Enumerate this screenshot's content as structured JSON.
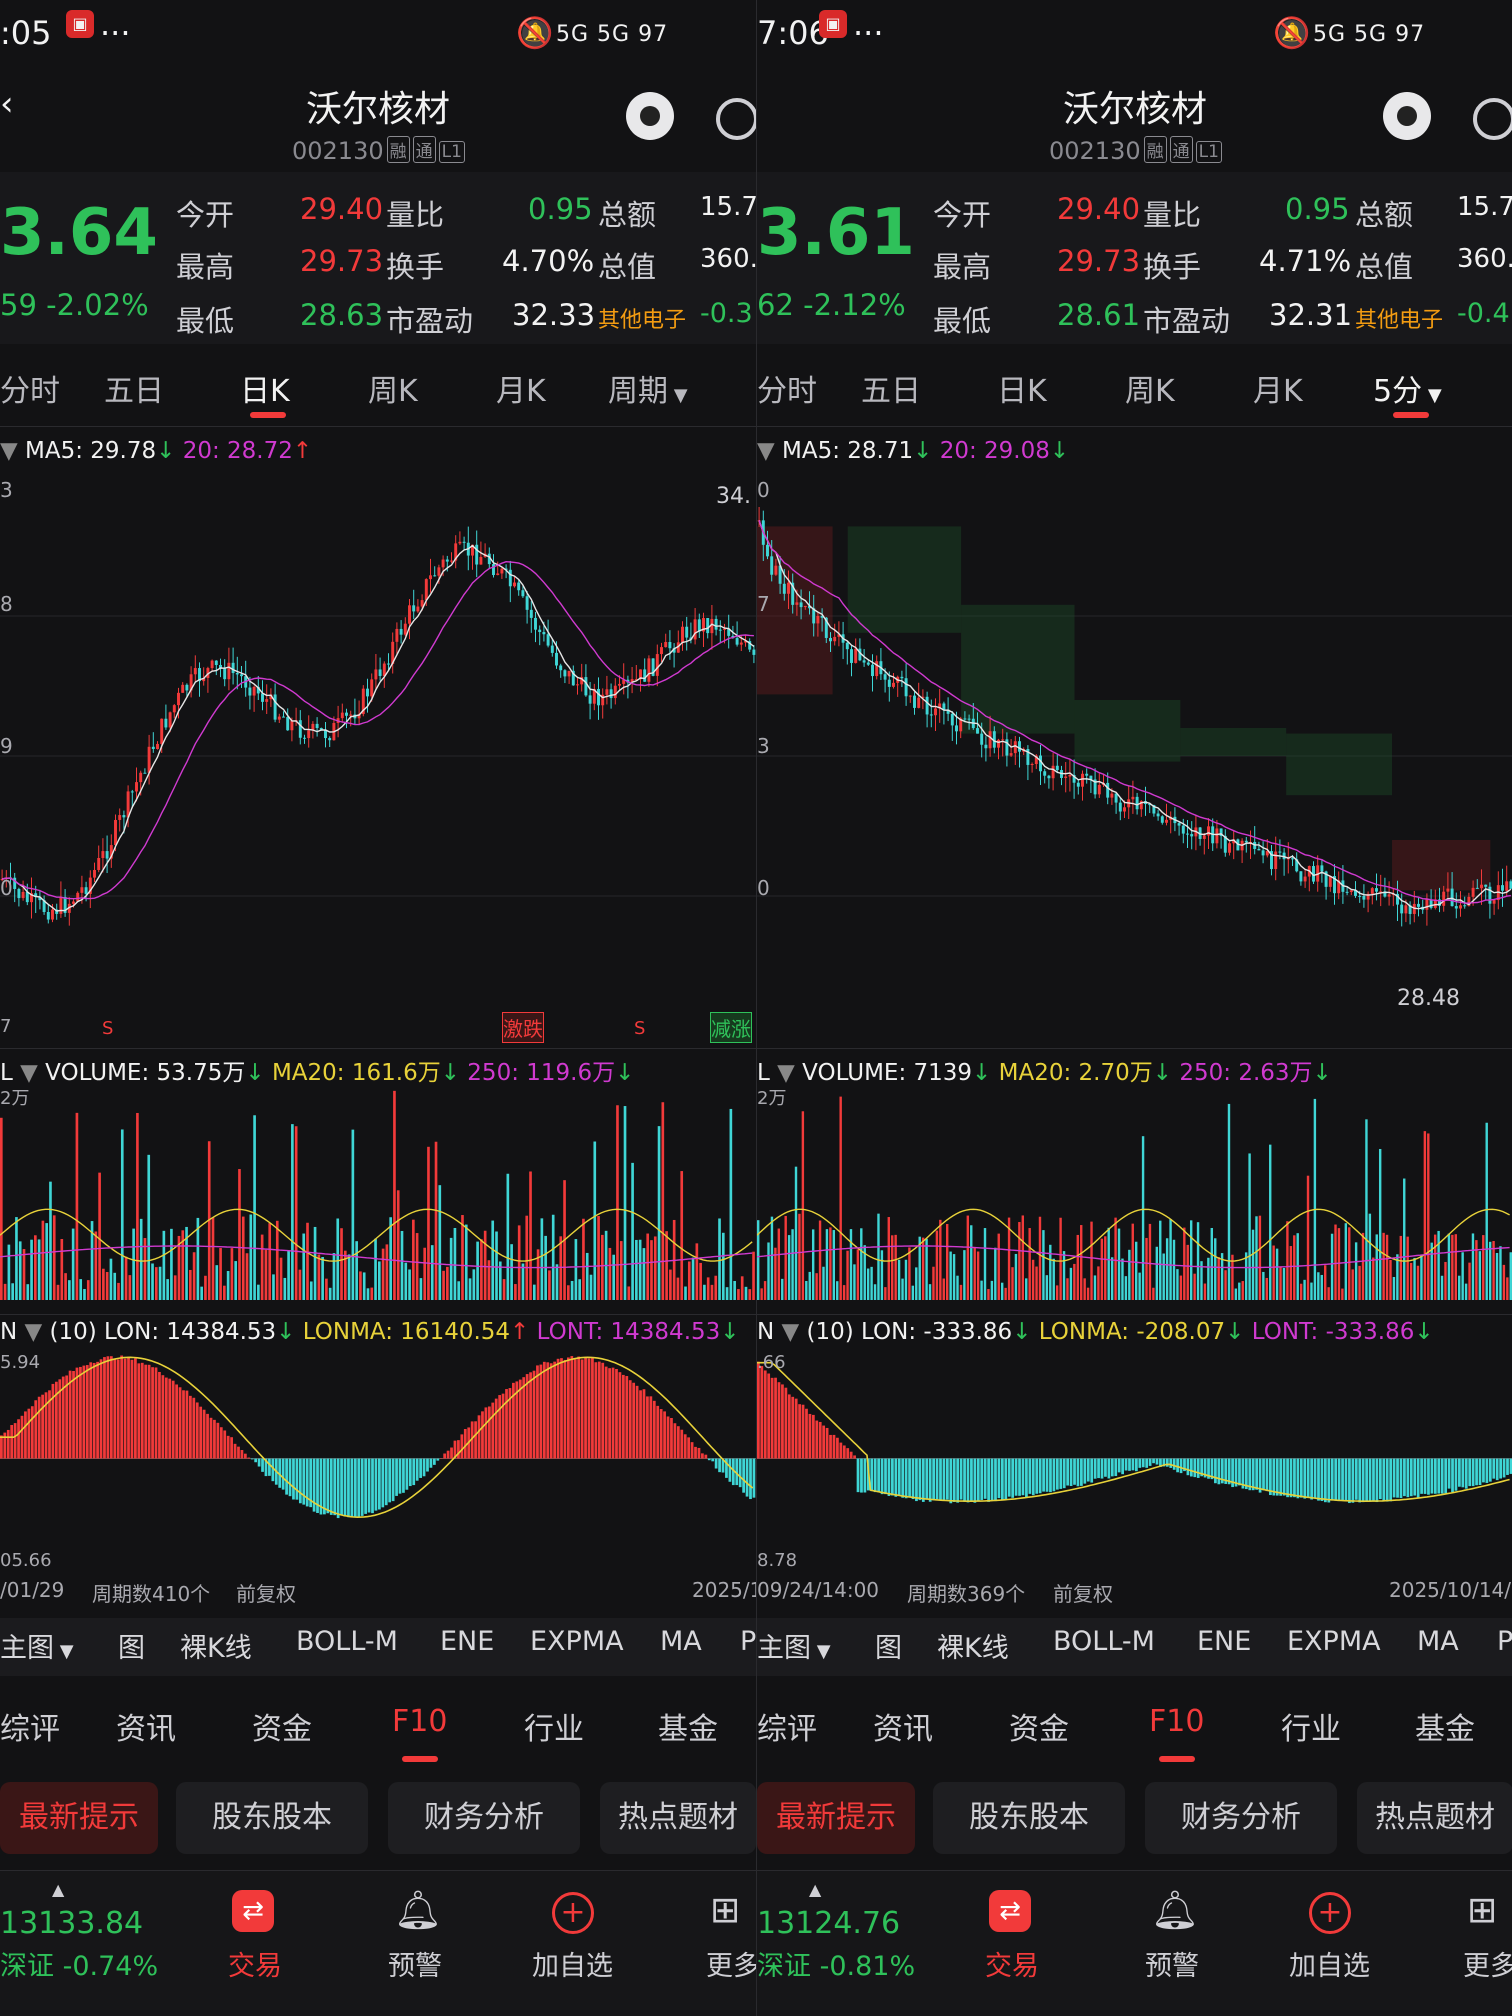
{
  "colors": {
    "up": "#f23a3a",
    "down": "#2fc15a",
    "vol_down": "#3fd6d6",
    "ma5": "#e6e6e6",
    "ma20": "#d03ad0",
    "vol_ma20": "#e8d23a",
    "orange": "#f39c12"
  },
  "left": {
    "status_time": ":05",
    "status_more": "···",
    "status_right": "5G 5G 97",
    "title": "沃尔核材",
    "code": "002130",
    "tags": [
      "融",
      "通",
      "L1"
    ],
    "price": "3.64",
    "change": "59 -2.02%",
    "quote_rows": [
      {
        "l1": "今开",
        "v1": "29.40",
        "l2": "量比",
        "v2": "0.95",
        "l3": "总额",
        "v3": "15.7"
      },
      {
        "l1": "最高",
        "v1": "29.73",
        "l2": "换手",
        "v2": "4.70%",
        "l3": "总值",
        "v3": "360."
      },
      {
        "l1": "最低",
        "v1": "28.63",
        "l2": "市盈动",
        "v2": "32.33",
        "l3": "其他电子",
        "v3": "-0.3"
      }
    ],
    "tabs": [
      "分时",
      "五日",
      "日K",
      "周K",
      "月K",
      "周期"
    ],
    "active_tab": "日K",
    "ma_line": {
      "ma5": "MA5: 29.78",
      "ma20": "20: 28.72"
    },
    "y_labels": [
      "3",
      "8",
      "9",
      "0",
      "7"
    ],
    "top_label": "34.",
    "signals": [
      "S",
      "激跌",
      "S",
      "减涨"
    ],
    "volume_line": {
      "title": "L",
      "vol": "VOLUME: 53.75万",
      "ma20": "MA20: 161.6万",
      "ma250": "250: 119.6万"
    },
    "vol_axis": "2万",
    "lon_line": {
      "title": "N",
      "lon": "(10) LON: 14384.53",
      "lonma": "LONMA: 16140.54",
      "lont": "LONT: 14384.53"
    },
    "lon_top": "5.94",
    "lon_bottom": "05.66",
    "footer": {
      "date": "/01/29",
      "count": "周期数410个",
      "adj": "前复权",
      "end": "2025/1"
    },
    "tools": [
      "主图",
      "图",
      "裸K线",
      "BOLL-M",
      "ENE",
      "EXPMA",
      "MA",
      "P"
    ],
    "nav": [
      "综评",
      "资讯",
      "资金",
      "F10",
      "行业",
      "基金"
    ],
    "active_nav": "F10",
    "chips": [
      "最新提示",
      "股东股本",
      "财务分析",
      "热点题材"
    ],
    "bottom": {
      "index_val": "13133.84",
      "index_lbl": "深证 -0.74%",
      "trade": "交易",
      "alert": "预警",
      "add": "加自选",
      "more": "更多"
    }
  },
  "right": {
    "status_time": "7:06",
    "status_more": "···",
    "status_right": "5G 5G 97",
    "title": "沃尔核材",
    "code": "002130",
    "tags": [
      "融",
      "通",
      "L1"
    ],
    "price": "3.61",
    "change": "62 -2.12%",
    "quote_rows": [
      {
        "l1": "今开",
        "v1": "29.40",
        "l2": "量比",
        "v2": "0.95",
        "l3": "总额",
        "v3": "15.7"
      },
      {
        "l1": "最高",
        "v1": "29.73",
        "l2": "换手",
        "v2": "4.71%",
        "l3": "总值",
        "v3": "360."
      },
      {
        "l1": "最低",
        "v1": "28.61",
        "l2": "市盈动",
        "v2": "32.31",
        "l3": "其他电子",
        "v3": "-0.4"
      }
    ],
    "tabs": [
      "分时",
      "五日",
      "日K",
      "周K",
      "月K",
      "5分"
    ],
    "active_tab": "5分",
    "ma_line": {
      "ma5": "MA5: 28.71",
      "ma20": "20: 29.08"
    },
    "y_labels": [
      "0",
      "7",
      "3",
      "0"
    ],
    "low_label": "28.48",
    "volume_line": {
      "title": "L",
      "vol": "VOLUME: 7139",
      "ma20": "MA20: 2.70万",
      "ma250": "250: 2.63万"
    },
    "vol_axis": "2万",
    "lon_line": {
      "title": "N",
      "lon": "(10) LON: -333.86",
      "lonma": "LONMA: -208.07",
      "lont": "LONT: -333.86"
    },
    "lon_top": ".66",
    "lon_bottom": "8.78",
    "footer": {
      "date": "09/24/14:00",
      "count": "周期数369个",
      "adj": "前复权",
      "end": "2025/10/14/1"
    },
    "tools": [
      "主图",
      "图",
      "裸K线",
      "BOLL-M",
      "ENE",
      "EXPMA",
      "MA",
      "P"
    ],
    "nav": [
      "综评",
      "资讯",
      "资金",
      "F10",
      "行业",
      "基金"
    ],
    "active_nav": "F10",
    "chips": [
      "最新提示",
      "股东股本",
      "财务分析",
      "热点题材"
    ],
    "bottom": {
      "index_val": "13124.76",
      "index_lbl": "深证 -0.81%",
      "trade": "交易",
      "alert": "预警",
      "add": "加自选",
      "more": "更多"
    }
  }
}
